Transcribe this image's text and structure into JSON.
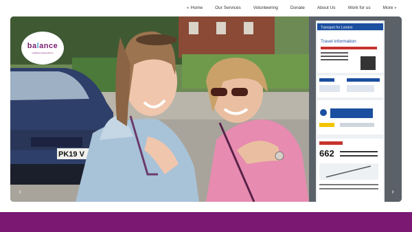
{
  "nav": {
    "items": [
      {
        "label": "Home",
        "has_caret": true
      },
      {
        "label": "Our Services",
        "has_caret": false
      },
      {
        "label": "Volunteering",
        "has_caret": false
      },
      {
        "label": "Donate",
        "has_caret": false
      },
      {
        "label": "About Us",
        "has_caret": false
      },
      {
        "label": "Work for us",
        "has_caret": false
      },
      {
        "label": "More",
        "has_caret": true
      }
    ]
  },
  "logo": {
    "word_start": "ba",
    "word_accent": "l",
    "word_end": "ance",
    "tagline": "enabling independence"
  },
  "hero": {
    "plate": "PK19 V",
    "sign": {
      "header": "Transport for London",
      "title": "Travel information",
      "bus_number": "662"
    }
  },
  "slider": {
    "prev_icon": "chevron-left-icon",
    "next_icon": "chevron-right-icon",
    "prev_glyph": "‹",
    "next_glyph": "›"
  },
  "colors": {
    "brand": "#7b1872",
    "accent": "#4aa6c6"
  }
}
